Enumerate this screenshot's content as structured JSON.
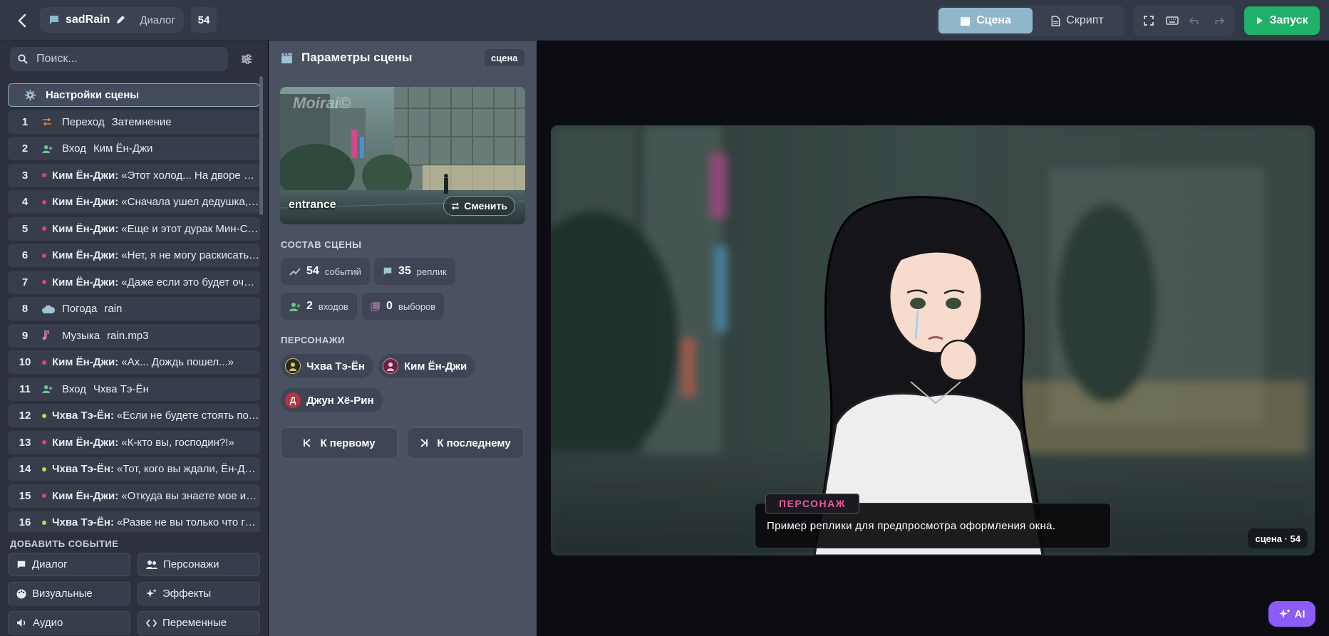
{
  "header": {
    "project_name": "sadRain",
    "project_type": "Диалог",
    "event_count": "54",
    "modes": [
      {
        "label": "Сцена",
        "icon": "clapperboard-icon",
        "active": true
      },
      {
        "label": "Скрипт",
        "icon": "document-icon",
        "active": false
      }
    ],
    "tools": [
      "fullscreen-icon",
      "keyboard-icon",
      "undo-icon",
      "redo-icon"
    ],
    "run_label": "Запуск"
  },
  "sidebar": {
    "search_placeholder": "Поиск...",
    "settings_label": "Настройки сцены",
    "events": [
      {
        "num": "1",
        "kind": "transition",
        "label": "Переход",
        "detail": "Затемнение"
      },
      {
        "num": "2",
        "kind": "enter",
        "label": "Вход",
        "detail": "Ким Ён-Джи"
      },
      {
        "num": "3",
        "kind": "dialog",
        "speaker": "Ким Ён-Джи:",
        "text": "«Этот холод... На дворе ещ...",
        "dot": "#e0456b"
      },
      {
        "num": "4",
        "kind": "dialog",
        "speaker": "Ким Ён-Джи:",
        "text": "«Сначала ушел дедушка, а ...",
        "dot": "#e0456b"
      },
      {
        "num": "5",
        "kind": "dialog",
        "speaker": "Ким Ён-Джи:",
        "text": "«Еще и этот дурак Мин-Сок...",
        "dot": "#e0456b"
      },
      {
        "num": "6",
        "kind": "dialog",
        "speaker": "Ким Ён-Джи:",
        "text": "«Нет, я не могу раскисать! ...",
        "dot": "#e0456b"
      },
      {
        "num": "7",
        "kind": "dialog",
        "speaker": "Ким Ён-Джи:",
        "text": "«Даже если это будет очен...",
        "dot": "#e0456b"
      },
      {
        "num": "8",
        "kind": "weather",
        "label": "Погода",
        "detail": "rain"
      },
      {
        "num": "9",
        "kind": "music",
        "label": "Музыка",
        "detail": "rain.mp3"
      },
      {
        "num": "10",
        "kind": "dialog",
        "speaker": "Ким Ён-Джи:",
        "text": "«Ах... Дождь пошел...»",
        "dot": "#e0456b"
      },
      {
        "num": "11",
        "kind": "enter",
        "label": "Вход",
        "detail": "Чхва Тэ-Ён"
      },
      {
        "num": "12",
        "kind": "dialog",
        "speaker": "Чхва Тэ-Ён:",
        "text": "«Если не будете стоять под д...",
        "dot": "#c4d94a"
      },
      {
        "num": "13",
        "kind": "dialog",
        "speaker": "Ким Ён-Джи:",
        "text": "«К-кто вы, господин?!»",
        "dot": "#e0456b"
      },
      {
        "num": "14",
        "kind": "dialog",
        "speaker": "Чхва Тэ-Ён:",
        "text": "«Тот, кого вы ждали, Ён-Джи....",
        "dot": "#c4d94a"
      },
      {
        "num": "15",
        "kind": "dialog",
        "speaker": "Ким Ён-Джи:",
        "text": "«Откуда вы знаете мое имя...",
        "dot": "#e0456b"
      },
      {
        "num": "16",
        "kind": "dialog",
        "speaker": "Чхва Тэ-Ён:",
        "text": "«Разве не вы только что гов...",
        "dot": "#c4d94a"
      }
    ],
    "add_title": "ДОБАВИТЬ СОБЫТИЕ",
    "add_buttons": [
      {
        "label": "Диалог",
        "icon": "chat-icon"
      },
      {
        "label": "Персонажи",
        "icon": "people-icon"
      },
      {
        "label": "Визуальные",
        "icon": "palette-icon"
      },
      {
        "label": "Эффекты",
        "icon": "sparkle-icon"
      },
      {
        "label": "Аудио",
        "icon": "speaker-icon"
      },
      {
        "label": "Переменные",
        "icon": "code-icon"
      }
    ]
  },
  "scene_panel": {
    "title": "Параметры сцены",
    "badge": "сцена",
    "background_name": "entrance",
    "watermark": "Moirai©",
    "change_label": "Сменить",
    "composition_title": "СОСТАВ СЦЕНЫ",
    "stats": [
      {
        "value": "54",
        "label": "событий",
        "icon": "trend-icon"
      },
      {
        "value": "35",
        "label": "реплик",
        "icon": "chat-icon"
      },
      {
        "value": "2",
        "label": "входов",
        "icon": "person-add-icon"
      },
      {
        "value": "0",
        "label": "выборов",
        "icon": "choices-icon"
      }
    ],
    "characters_title": "ПЕРСОНАЖИ",
    "characters": [
      {
        "name": "Чхва Тэ-Ён",
        "color": "#2a2a1c"
      },
      {
        "name": "Ким Ён-Джи",
        "color": "#6b2440"
      },
      {
        "name": "Джун Хё-Рин",
        "color": "#b8323b",
        "initial": "Д"
      }
    ],
    "nav_first": "К первому",
    "nav_last": "К последнему"
  },
  "preview": {
    "speaker_tag": "ПЕРСОНАЖ",
    "dialog_text": "Пример реплики для предпросмотра оформления окна.",
    "scene_badge": "сцена · 54"
  },
  "ai_label": "AI",
  "colors": {
    "accent_active": "#8fb7c9",
    "run_green": "#1fb06a",
    "ai_purple": "#8b5cf6",
    "speaker_pink": "#ef5a9b"
  }
}
